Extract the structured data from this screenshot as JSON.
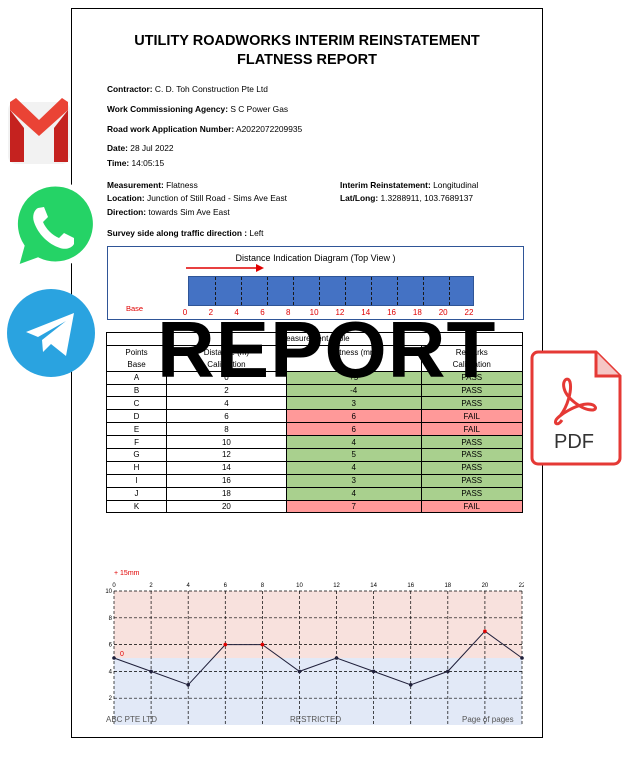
{
  "document": {
    "title_line1": "UTILITY ROADWORKS INTERIM REINSTATEMENT",
    "title_line2": "FLATNESS REPORT",
    "contractor_label": "Contractor:",
    "contractor_value": " C. D. Toh Construction Pte Ltd",
    "agency_label": "Work Commissioning Agency:",
    "agency_value": " S C Power Gas",
    "app_label": "Road work Application Number:",
    "app_value": " A2022072209935",
    "date_label": "Date:",
    "date_value": " 28 Jul 2022",
    "time_label": "Time:",
    "time_value": " 14:05:15",
    "measurement_label": "Measurement:",
    "measurement_value": " Flatness",
    "location_label": "Location:",
    "location_value": " Junction of Still Road - Sims Ave East",
    "direction_label": "Direction:",
    "direction_value": " towards Sim Ave East",
    "interim_label": "Interim Reinstatement:",
    "interim_value": " Longitudinal",
    "latlong_label": "Lat/Long:",
    "latlong_value": " 1.3288911, 103.7689137",
    "survey_label": "Survey side along traffic direction :",
    "survey_value": " Left"
  },
  "diagram": {
    "title": "Distance Indication Diagram (Top View )",
    "base_label": "Base",
    "distances": [
      "0",
      "2",
      "4",
      "6",
      "8",
      "10",
      "12",
      "14",
      "16",
      "18",
      "20",
      "22"
    ]
  },
  "table": {
    "caption": "Measurement Table",
    "headers": [
      "Points",
      "Distance (m)",
      "Flatness (mm)",
      "Remarks"
    ],
    "base_row": [
      "Base",
      "Calibration",
      "",
      "Calibration"
    ],
    "rows": [
      {
        "point": "A",
        "distance": "0",
        "flatness": "+5",
        "remark": "PASS",
        "status": "pass"
      },
      {
        "point": "B",
        "distance": "2",
        "flatness": "-4",
        "remark": "PASS",
        "status": "pass"
      },
      {
        "point": "C",
        "distance": "4",
        "flatness": "3",
        "remark": "PASS",
        "status": "pass"
      },
      {
        "point": "D",
        "distance": "6",
        "flatness": "6",
        "remark": "FAIL",
        "status": "fail"
      },
      {
        "point": "E",
        "distance": "8",
        "flatness": "6",
        "remark": "FAIL",
        "status": "fail"
      },
      {
        "point": "F",
        "distance": "10",
        "flatness": "4",
        "remark": "PASS",
        "status": "pass"
      },
      {
        "point": "G",
        "distance": "12",
        "flatness": "5",
        "remark": "PASS",
        "status": "pass"
      },
      {
        "point": "H",
        "distance": "14",
        "flatness": "4",
        "remark": "PASS",
        "status": "pass"
      },
      {
        "point": "I",
        "distance": "16",
        "flatness": "3",
        "remark": "PASS",
        "status": "pass"
      },
      {
        "point": "J",
        "distance": "18",
        "flatness": "4",
        "remark": "PASS",
        "status": "pass"
      },
      {
        "point": "K",
        "distance": "20",
        "flatness": "7",
        "remark": "FAIL",
        "status": "fail"
      }
    ]
  },
  "chart_data": {
    "type": "line",
    "title": "",
    "annotation_top": "+ 15mm",
    "annotation_zero": "0",
    "x": [
      0,
      2,
      4,
      6,
      8,
      10,
      12,
      14,
      16,
      18,
      20,
      22
    ],
    "x_ticks": [
      "0",
      "2",
      "4",
      "6",
      "8",
      "10",
      "12",
      "14",
      "16",
      "18",
      "20",
      "22"
    ],
    "y_ticks": [
      "10",
      "8",
      "6",
      "4",
      "2"
    ],
    "series": [
      {
        "values": [
          5,
          4,
          3,
          6,
          6,
          4,
          5,
          4,
          3,
          4,
          7,
          5
        ]
      }
    ],
    "xlim": [
      0,
      22
    ],
    "ylim": [
      0,
      10
    ],
    "grid": true,
    "colors": {
      "upper_band": "#f8e1dd",
      "lower_band": "#e2e9f7",
      "line": "#1f1f3a",
      "fail_point": "#e00000"
    }
  },
  "footer": {
    "left": "ABC PTE LTD",
    "middle": "RESTRICTED",
    "right": "Page  of  pages"
  },
  "overlay": {
    "watermark": "REPORT",
    "icons": [
      "gmail-icon",
      "whatsapp-icon",
      "telegram-icon",
      "pdf-icon"
    ],
    "pdf_label": "PDF"
  }
}
